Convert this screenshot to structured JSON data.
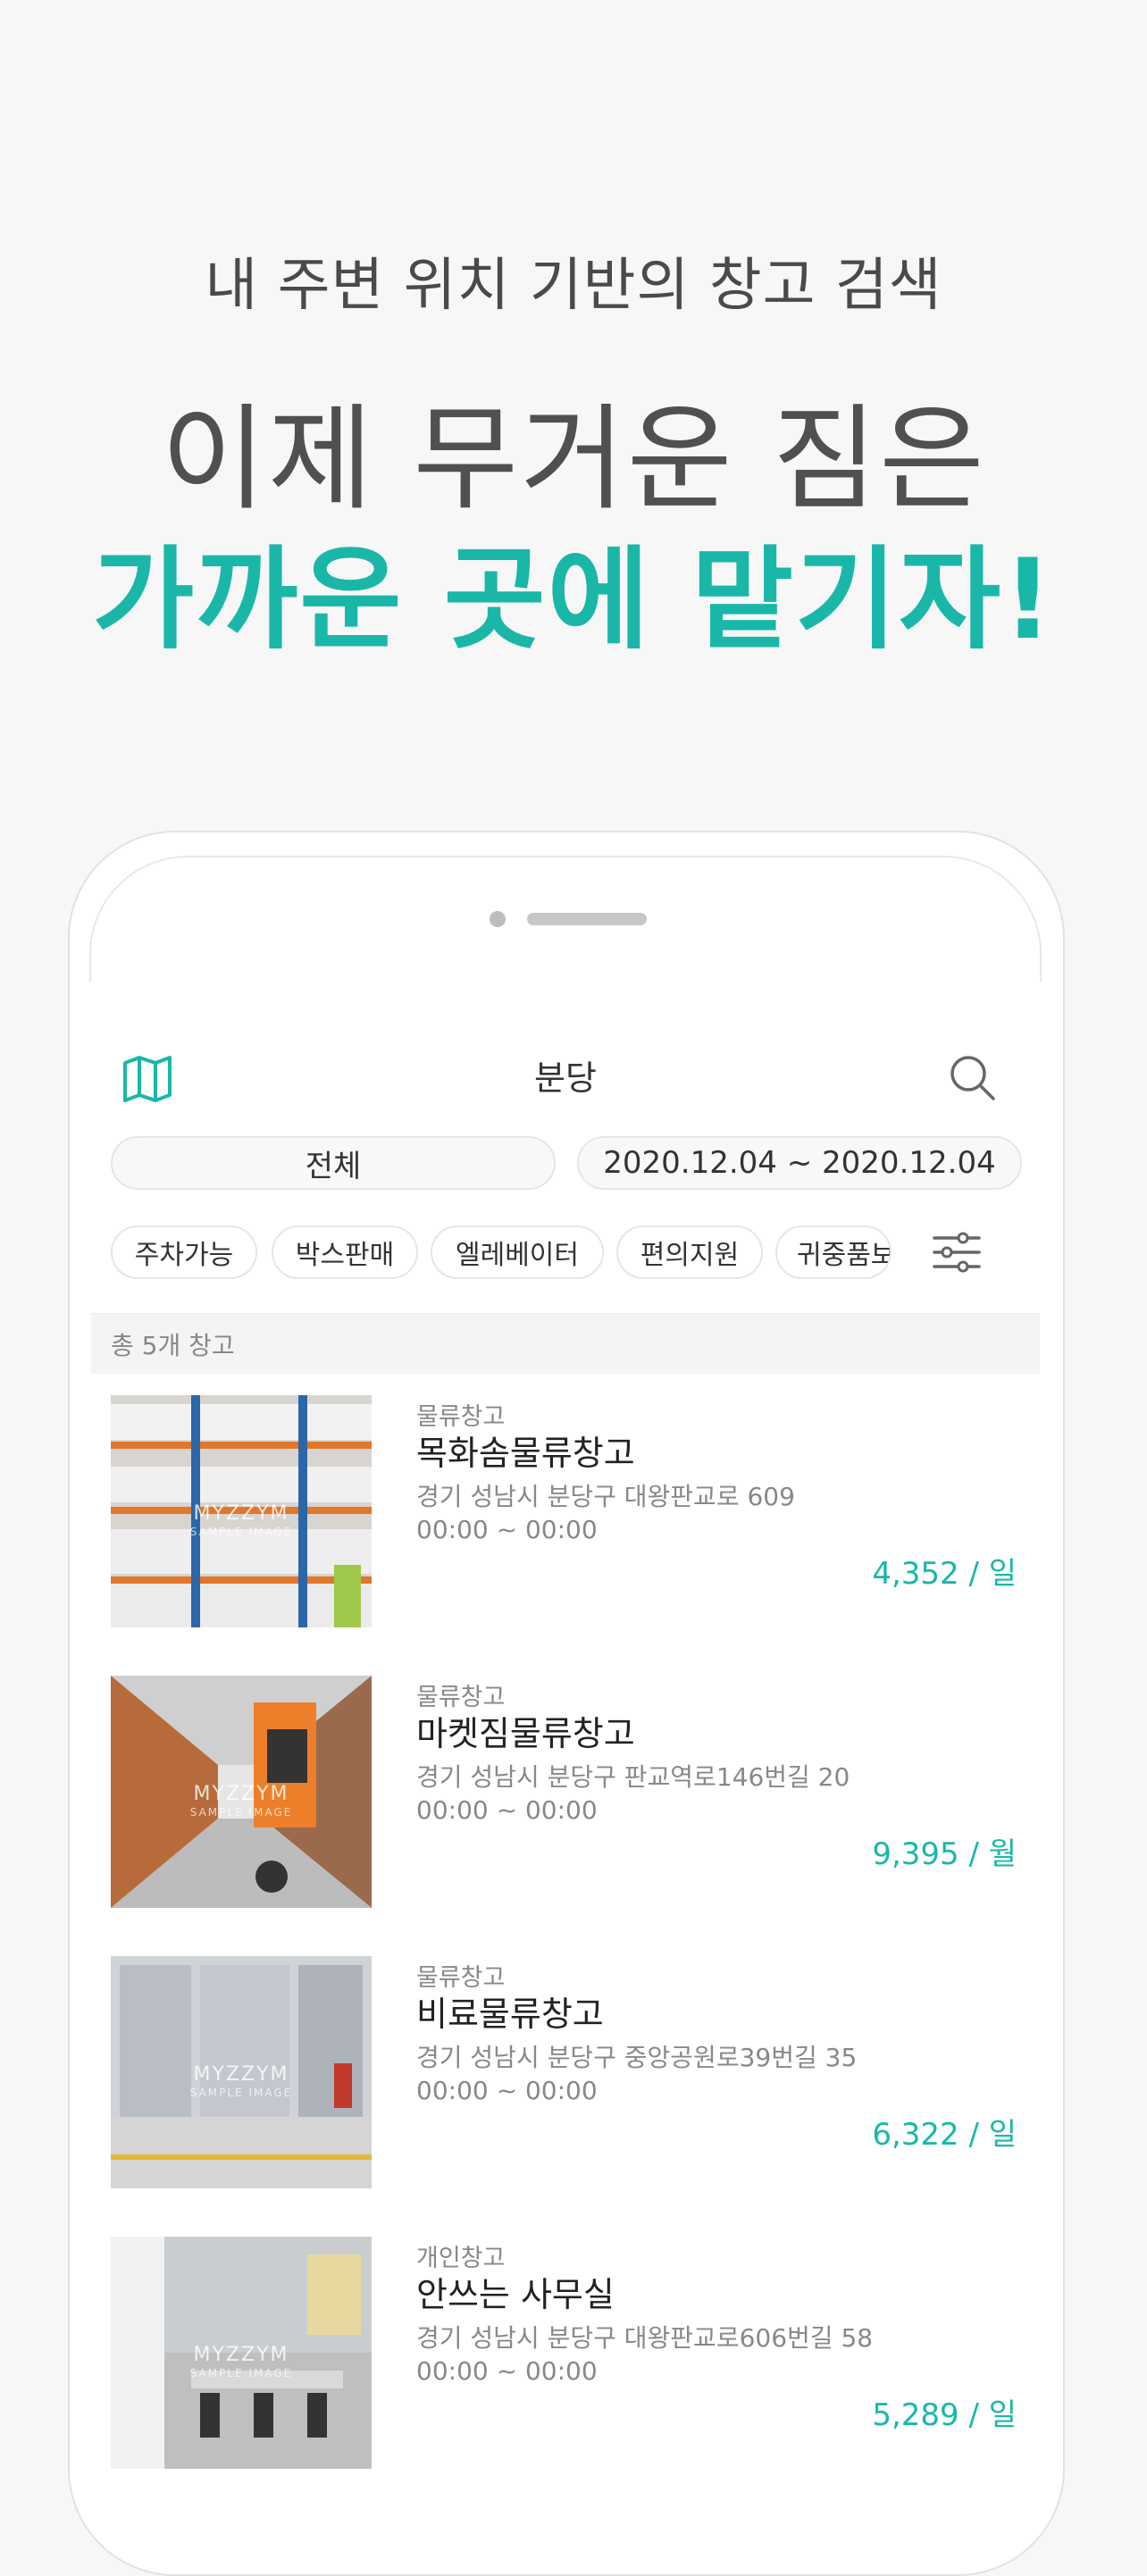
{
  "promo": {
    "subtitle": "내 주변 위치 기반의 창고 검색",
    "headline": "이제 무거운 짐은",
    "highlight": "가까운 곳에 맡기자!"
  },
  "app": {
    "location_title": "분당",
    "filter_all": "전체",
    "date_range": "2020.12.04 ~ 2020.12.04",
    "chips": [
      "주차가능",
      "박스판매",
      "엘레베이터",
      "편의지원",
      "귀중품보"
    ],
    "count_text": "총 5개 창고",
    "accent_color": "#1ab7a9",
    "listings": [
      {
        "type": "물류창고",
        "name": "목화솜물류창고",
        "address": "경기 성남시 분당구 대왕판교로 609",
        "hours": "00:00 ~ 00:00",
        "price": "4,352 / 일",
        "watermark": "MYZZYM",
        "watermark_sub": "SAMPLE IMAGE"
      },
      {
        "type": "물류창고",
        "name": "마켓짐물류창고",
        "address": "경기 성남시 분당구 판교역로146번길 20",
        "hours": "00:00 ~ 00:00",
        "price": "9,395 / 월",
        "watermark": "MYZZYM",
        "watermark_sub": "SAMPLE IMAGE"
      },
      {
        "type": "물류창고",
        "name": "비료물류창고",
        "address": "경기 성남시 분당구 중앙공원로39번길 35",
        "hours": "00:00 ~ 00:00",
        "price": "6,322 / 일",
        "watermark": "MYZZYM",
        "watermark_sub": "SAMPLE IMAGE"
      },
      {
        "type": "개인창고",
        "name": "안쓰는 사무실",
        "address": "경기 성남시 분당구 대왕판교로606번길 58",
        "hours": "00:00 ~ 00:00",
        "price": "5,289 / 일",
        "watermark": "MYZZYM",
        "watermark_sub": "SAMPLE IMAGE"
      }
    ]
  },
  "icons": {
    "map": "map-icon",
    "search": "search-icon",
    "filter": "sliders-icon"
  }
}
